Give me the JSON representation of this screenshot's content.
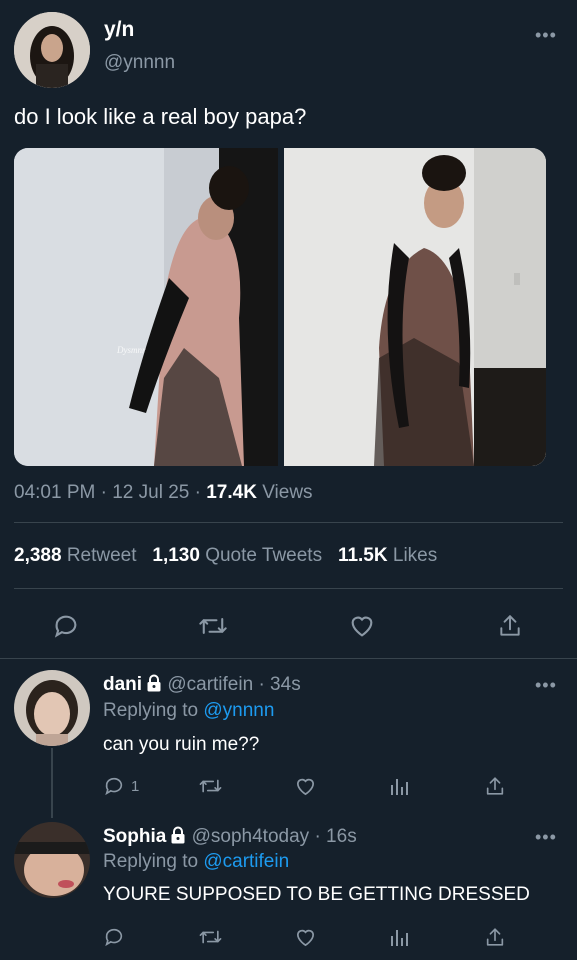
{
  "main_tweet": {
    "author_name": "y/n",
    "handle": "@ynnnn",
    "text": "do I look like a real boy papa?",
    "image_watermark": "Dysmnr",
    "time": "04:01 PM",
    "dot1": "·",
    "date": "12 Jul 25",
    "dot2": "·",
    "views_count": "17.4K",
    "views_label": "Views",
    "retweets_count": "2,388",
    "retweets_label": "Retweet",
    "quotes_count": "1,130",
    "quotes_label": "Quote Tweets",
    "likes_count": "11.5K",
    "likes_label": "Likes"
  },
  "replies": [
    {
      "name": "dani",
      "handle": "@cartifein",
      "time": "· 34s",
      "replying_prefix": "Replying to",
      "replying_to": "@ynnnn",
      "text": "can you ruin me??",
      "reply_count": "1"
    },
    {
      "name": "Sophia",
      "handle": "@soph4today",
      "time": "· 16s",
      "replying_prefix": "Replying to",
      "replying_to": "@cartifein",
      "text": "YOURE SUPPOSED TO BE GETTING DRESSED"
    }
  ],
  "colors": {
    "background": "#15202b",
    "text": "#ffffff",
    "muted": "#8b98a5",
    "link": "#1d9bf0",
    "divider": "#38444d"
  },
  "icons": [
    "more-icon",
    "reply-icon",
    "retweet-icon",
    "like-icon",
    "share-icon",
    "analytics-icon",
    "lock-icon"
  ]
}
